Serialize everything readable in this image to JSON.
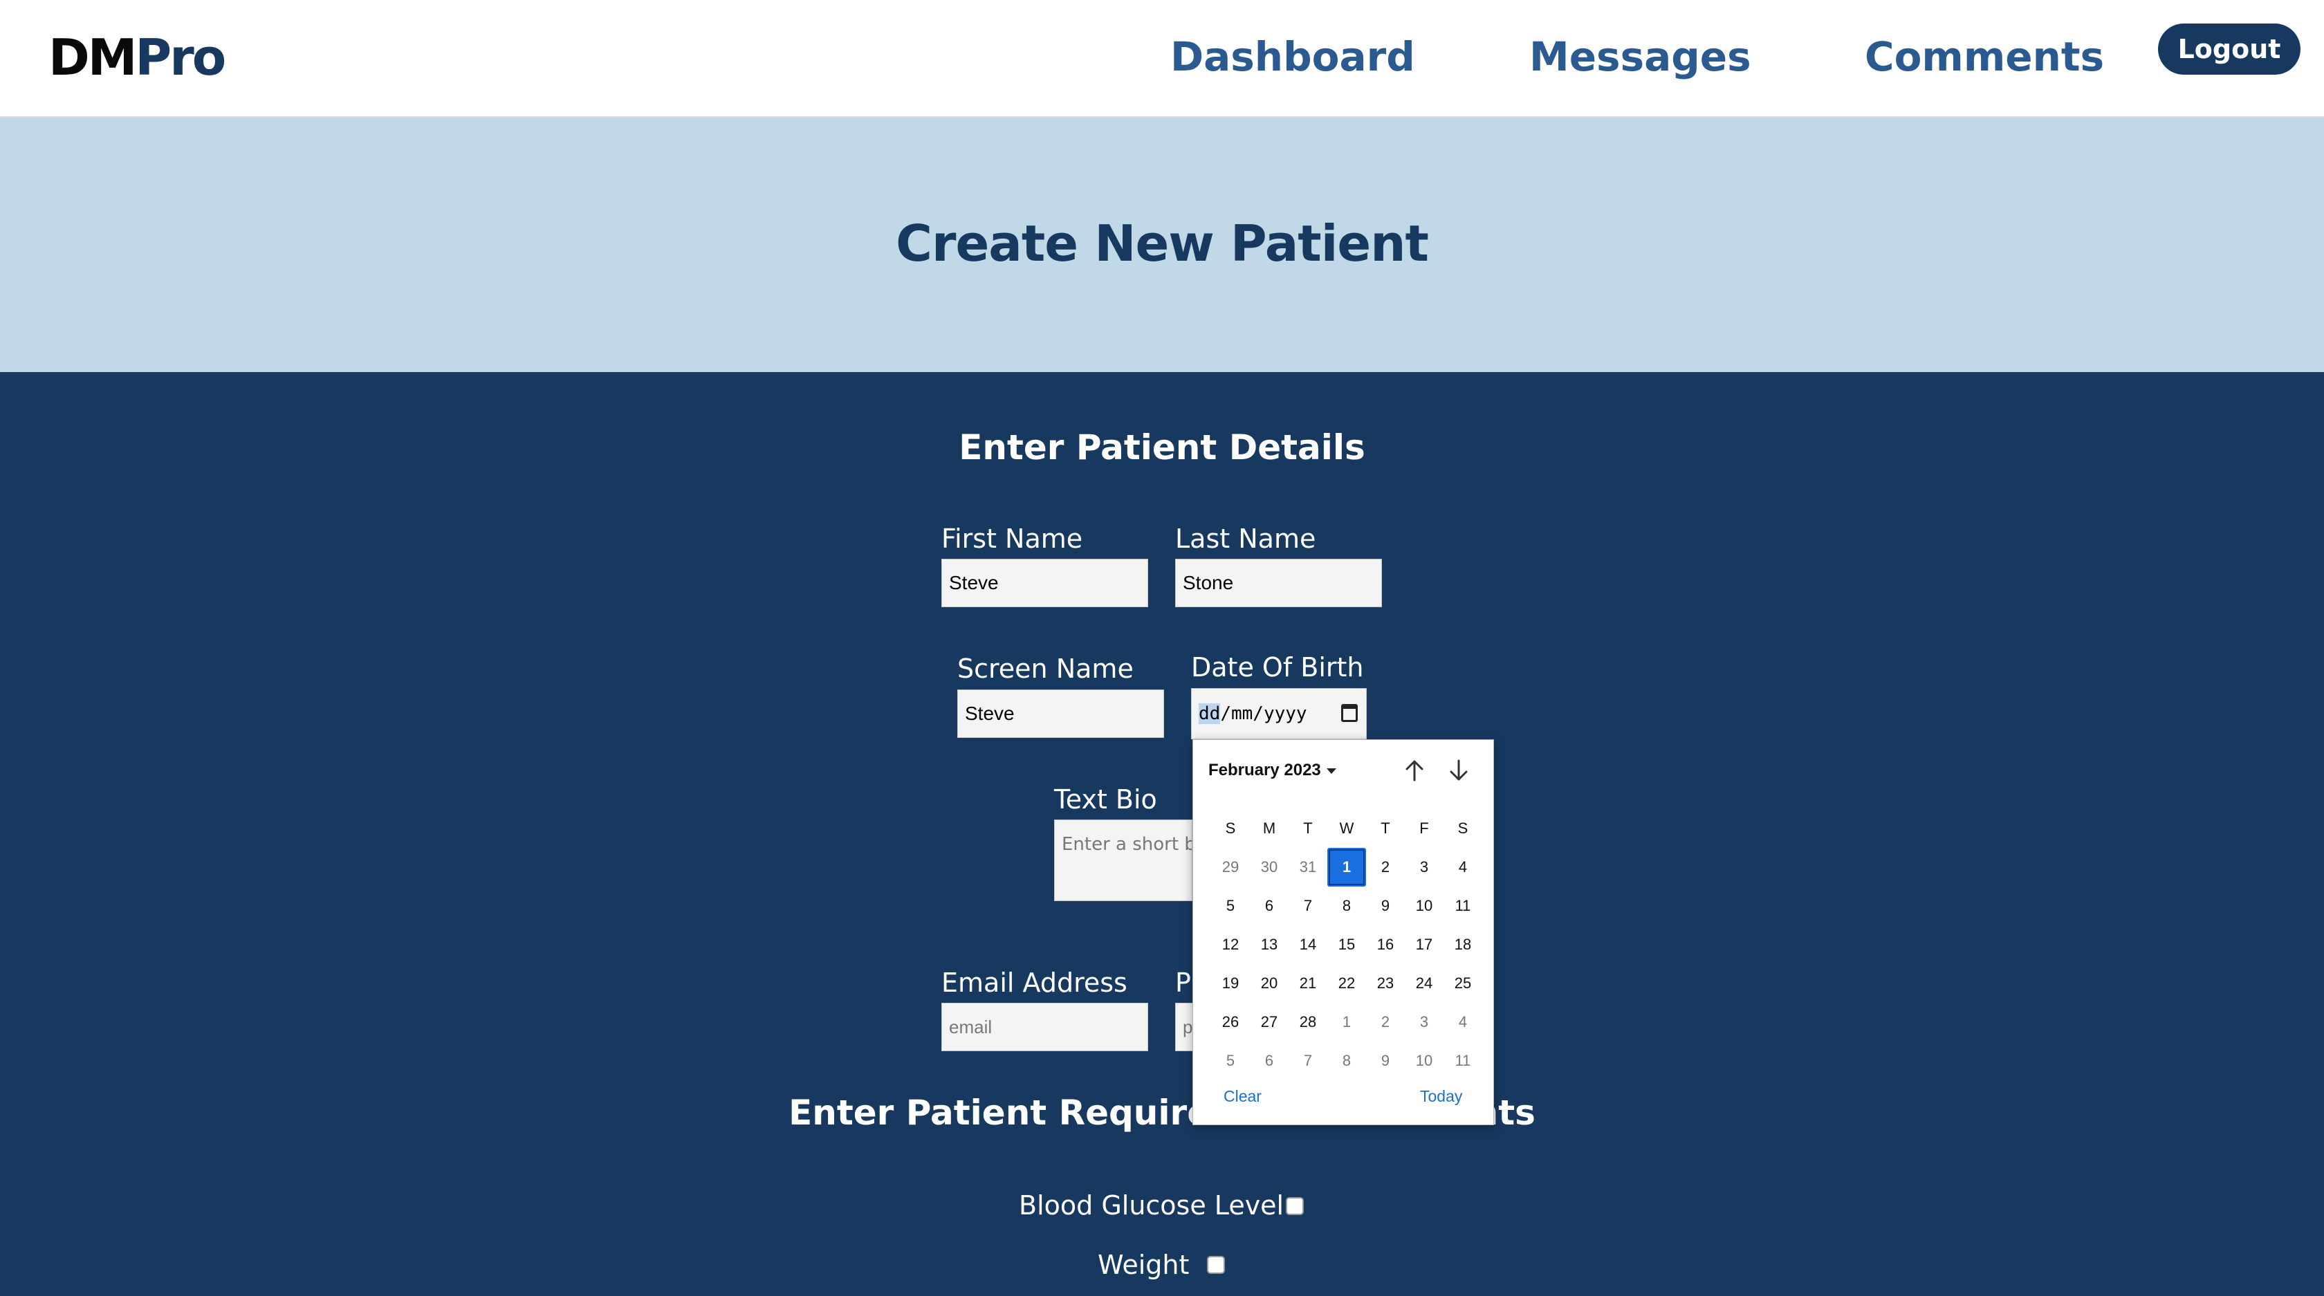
{
  "header": {
    "logo_dm": "DM",
    "logo_pro": "Pro",
    "nav": {
      "dashboard": "Dashboard",
      "messages": "Messages",
      "comments": "Comments"
    },
    "logout": "Logout"
  },
  "hero": {
    "title": "Create New Patient"
  },
  "form": {
    "details_title": "Enter Patient Details",
    "first_name": {
      "label": "First Name",
      "value": "Steve"
    },
    "last_name": {
      "label": "Last Name",
      "value": "Stone"
    },
    "screen_name": {
      "label": "Screen Name",
      "value": "Steve"
    },
    "dob": {
      "label": "Date Of Birth",
      "dd": "dd",
      "mm": "mm",
      "yyyy": "yyyy",
      "sep": "/"
    },
    "bio": {
      "label": "Text Bio",
      "placeholder": "Enter a short b"
    },
    "email": {
      "label": "Email Address",
      "placeholder": "email"
    },
    "phone": {
      "label": "P",
      "placeholder": "p"
    },
    "measurements_title": "Enter Patient Required Measurements",
    "measurements": [
      {
        "label": "Blood Glucose Level",
        "checked": false
      },
      {
        "label": "Weight",
        "checked": false
      }
    ]
  },
  "calendar": {
    "month_label": "February 2023",
    "weekdays": [
      "S",
      "M",
      "T",
      "W",
      "T",
      "F",
      "S"
    ],
    "days": [
      [
        "29",
        "30",
        "31",
        "1",
        "2",
        "3",
        "4"
      ],
      [
        "5",
        "6",
        "7",
        "8",
        "9",
        "10",
        "11"
      ],
      [
        "12",
        "13",
        "14",
        "15",
        "16",
        "17",
        "18"
      ],
      [
        "19",
        "20",
        "21",
        "22",
        "23",
        "24",
        "25"
      ],
      [
        "26",
        "27",
        "28",
        "1",
        "2",
        "3",
        "4"
      ],
      [
        "5",
        "6",
        "7",
        "8",
        "9",
        "10",
        "11"
      ]
    ],
    "selected_day": "1",
    "clear": "Clear",
    "today": "Today"
  },
  "colors": {
    "navy": "#173960",
    "light_blue": "#c1d9e7",
    "nav_text": "#2a5a8f",
    "calendar_accent": "#1a6fe0"
  }
}
